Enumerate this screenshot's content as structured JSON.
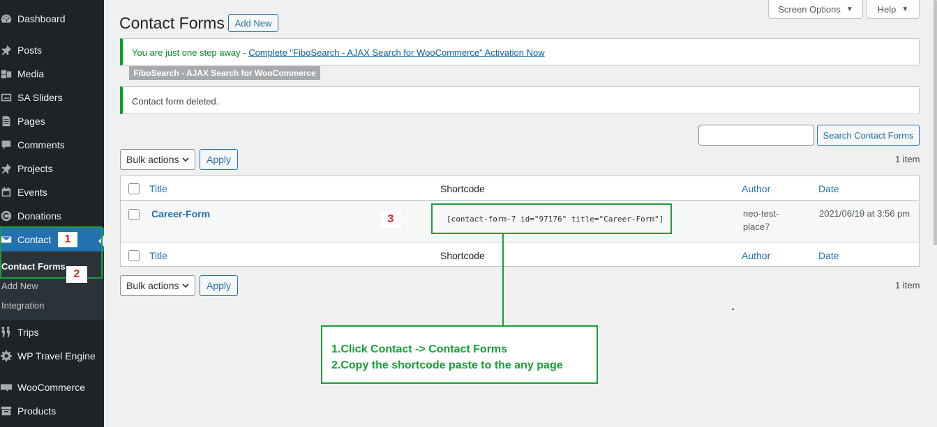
{
  "sidebar": {
    "items": [
      {
        "label": "Dashboard",
        "icon": "dashboard-icon"
      },
      {
        "label": "Posts",
        "icon": "pin-icon"
      },
      {
        "label": "Media",
        "icon": "media-icon"
      },
      {
        "label": "SA Sliders",
        "icon": "slides-icon"
      },
      {
        "label": "Pages",
        "icon": "page-icon"
      },
      {
        "label": "Comments",
        "icon": "comment-icon"
      },
      {
        "label": "Projects",
        "icon": "pin-icon"
      },
      {
        "label": "Events",
        "icon": "calendar-icon"
      },
      {
        "label": "Donations",
        "icon": "donation-icon"
      },
      {
        "label": "Contact",
        "icon": "envelope-icon",
        "current": true
      },
      {
        "label": "Trips",
        "icon": "hikers-icon"
      },
      {
        "label": "WP Travel Engine",
        "icon": "gear-icon"
      },
      {
        "label": "WooCommerce",
        "icon": "woo-icon"
      },
      {
        "label": "Products",
        "icon": "archive-icon"
      }
    ],
    "submenu": [
      {
        "label": "Contact Forms",
        "current": true
      },
      {
        "label": "Add New"
      },
      {
        "label": "Integration"
      }
    ]
  },
  "top_tabs": {
    "screen_options": "Screen Options",
    "help": "Help"
  },
  "page": {
    "title": "Contact Forms",
    "add_new": "Add New"
  },
  "notices": {
    "fibo_prefix": "You are just one step away - ",
    "fibo_link": "Complete \"FiboSearch - AJAX Search for WooCommerce\" Activation Now",
    "fibo_tag": "FiboSearch - AJAX Search for WooCommerce",
    "deleted": "Contact form deleted."
  },
  "search": {
    "value": "",
    "button": "Search Contact Forms"
  },
  "bulk": {
    "label": "Bulk actions",
    "apply": "Apply",
    "count": "1 item"
  },
  "table": {
    "columns": {
      "title": "Title",
      "shortcode": "Shortcode",
      "author": "Author",
      "date": "Date"
    },
    "rows": [
      {
        "title": "Career-Form",
        "shortcode": "[contact-form-7 id=\"97176\" title=\"Career-Form\"]",
        "author_line1": "neo-test-",
        "author_line2": "place7",
        "date": "2021/06/19 at 3:56 pm"
      }
    ]
  },
  "annotations": {
    "badge1": "1",
    "badge2": "2",
    "badge3": "3",
    "callout_line1": "1.Click Contact -> Contact Forms",
    "callout_line2": "2.Copy the shortcode paste to the any page",
    "color": "#1a9e3b"
  },
  "colors": {
    "sidebar_bg": "#1d2327",
    "accent": "#2271b1",
    "notice_green": "#00a32a"
  }
}
